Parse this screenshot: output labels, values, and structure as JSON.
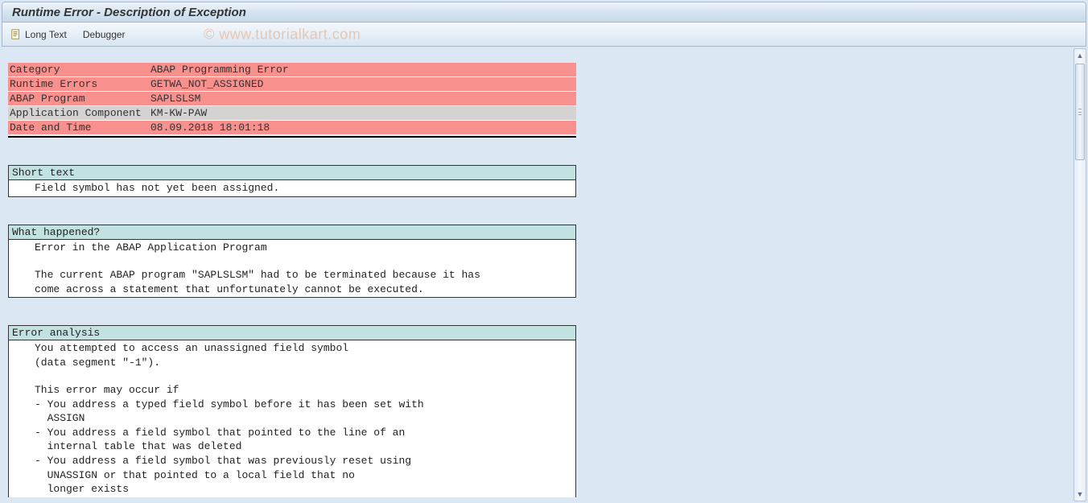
{
  "title": "Runtime Error - Description of Exception",
  "toolbar": {
    "long_text_label": "Long Text",
    "debugger_label": "Debugger"
  },
  "watermark": "© www.tutorialkart.com",
  "info_rows": [
    {
      "label": "Category",
      "value": "ABAP Programming Error",
      "cls": "red"
    },
    {
      "label": "Runtime Errors",
      "value": "GETWA_NOT_ASSIGNED",
      "cls": "red"
    },
    {
      "label": "ABAP Program",
      "value": "SAPLSLSM",
      "cls": "red"
    },
    {
      "label": "Application Component",
      "value": "KM-KW-PAW",
      "cls": "gray"
    },
    {
      "label": "Date and Time",
      "value": "08.09.2018 18:01:18",
      "cls": "red"
    }
  ],
  "sections": {
    "short_text": {
      "header": "Short text",
      "lines": [
        "Field symbol has not yet been assigned."
      ]
    },
    "what_happened": {
      "header": "What happened?",
      "lines": [
        "Error in the ABAP Application Program",
        "",
        "The current ABAP program \"SAPLSLSM\" had to be terminated because it has",
        "come across a statement that unfortunately cannot be executed."
      ]
    },
    "error_analysis": {
      "header": "Error analysis",
      "lines": [
        "You attempted to access an unassigned field symbol",
        "(data segment \"-1\").",
        "",
        "This error may occur if",
        "- You address a typed field symbol before it has been set with",
        "  ASSIGN",
        "- You address a field symbol that pointed to the line of an",
        "  internal table that was deleted",
        "- You address a field symbol that was previously reset using",
        "  UNASSIGN or that pointed to a local field that no",
        "  longer exists"
      ]
    }
  }
}
